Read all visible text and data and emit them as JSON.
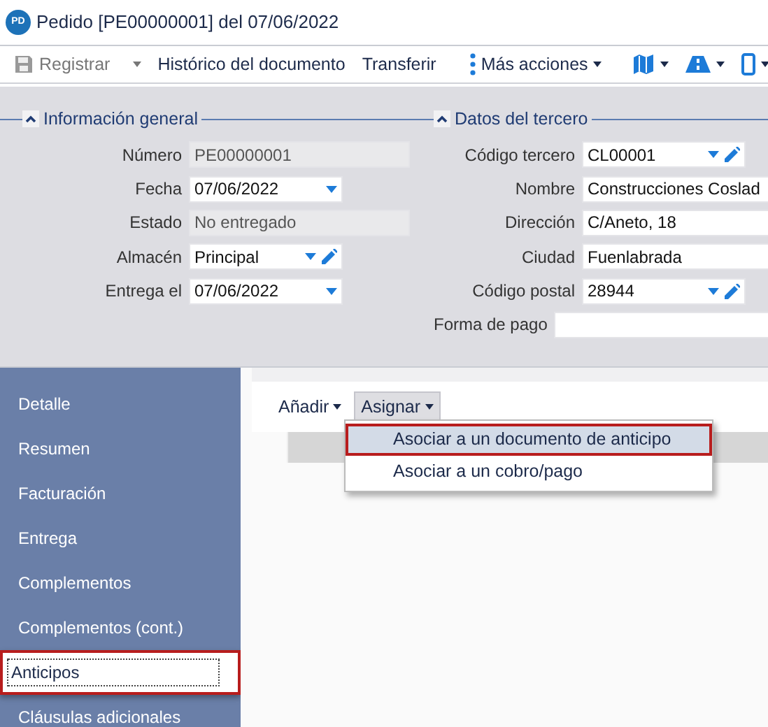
{
  "window": {
    "title": "Pedido [PE00000001] del 07/06/2022",
    "badge": "PD"
  },
  "toolbar": [
    {
      "kind": "save",
      "label": "Registrar",
      "disabled": true,
      "caret": true
    },
    {
      "kind": "text",
      "label": "Histórico del documento",
      "disabled": false,
      "caret": false
    },
    {
      "kind": "text",
      "label": "Transferir",
      "disabled": false,
      "caret": false
    },
    {
      "kind": "more",
      "label": "Más acciones",
      "disabled": false,
      "caret": true
    },
    {
      "kind": "map",
      "disabled": false,
      "caret": true
    },
    {
      "kind": "road",
      "disabled": false,
      "caret": true
    },
    {
      "kind": "phone",
      "disabled": false,
      "caret": true
    }
  ],
  "sections": [
    {
      "title": "Información general",
      "expanded": true,
      "fields": [
        {
          "kind": "long",
          "label": "Número",
          "value": "PE00000001",
          "disabled": true,
          "dropdown": false,
          "edit": false
        },
        {
          "kind": "standard",
          "label": "Fecha",
          "value": "07/06/2022",
          "disabled": false,
          "dropdown": true,
          "edit": false
        },
        {
          "kind": "long",
          "label": "Estado",
          "value": "No entregado",
          "disabled": true,
          "dropdown": false,
          "edit": false
        },
        {
          "kind": "standard",
          "label": "Almacén",
          "value": "Principal",
          "disabled": false,
          "dropdown": true,
          "edit": true
        },
        {
          "kind": "standard",
          "label": "Entrega el",
          "value": "07/06/2022",
          "disabled": false,
          "dropdown": true,
          "edit": false
        }
      ]
    },
    {
      "title": "Datos del tercero",
      "expanded": true,
      "fields": [
        {
          "kind": "standard",
          "label": "Código tercero",
          "value": "CL00001",
          "disabled": false,
          "dropdown": true,
          "edit": true
        },
        {
          "kind": "wide",
          "label": "Nombre",
          "value": "Construcciones Coslad",
          "disabled": false,
          "dropdown": false,
          "edit": false
        },
        {
          "kind": "wide",
          "label": "Dirección",
          "value": "C/Aneto, 18",
          "disabled": false,
          "dropdown": false,
          "edit": false
        },
        {
          "kind": "wide",
          "label": "Ciudad",
          "value": "Fuenlabrada",
          "disabled": false,
          "dropdown": false,
          "edit": false
        },
        {
          "kind": "standard",
          "label": "Código postal",
          "value": "28944",
          "disabled": false,
          "dropdown": true,
          "edit": true
        },
        {
          "kind": "inline",
          "label": "Forma de pago",
          "disabled": false,
          "dropdown": false,
          "edit": false
        }
      ]
    }
  ],
  "sidebar": {
    "items": [
      {
        "label": "Detalle",
        "selected": false,
        "highlighted": false
      },
      {
        "label": "Resumen",
        "selected": false,
        "highlighted": false
      },
      {
        "label": "Facturación",
        "selected": false,
        "highlighted": false
      },
      {
        "label": "Entrega",
        "selected": false,
        "highlighted": false
      },
      {
        "label": "Complementos",
        "selected": false,
        "highlighted": false
      },
      {
        "label": "Complementos (cont.)",
        "selected": false,
        "highlighted": false
      },
      {
        "label": "Anticipos",
        "selected": true,
        "highlighted": true
      },
      {
        "label": "Cláusulas adicionales",
        "selected": false,
        "highlighted": false
      }
    ]
  },
  "content_toolbar": [
    {
      "label": "Añadir",
      "expanded": false
    },
    {
      "label": "Asignar",
      "expanded": true
    }
  ],
  "menu": {
    "items": [
      {
        "label": "Asociar a un documento de anticipo",
        "selected": true,
        "highlighted": true
      },
      {
        "label": "Asociar a un cobro/pago",
        "selected": false,
        "highlighted": false
      }
    ]
  }
}
